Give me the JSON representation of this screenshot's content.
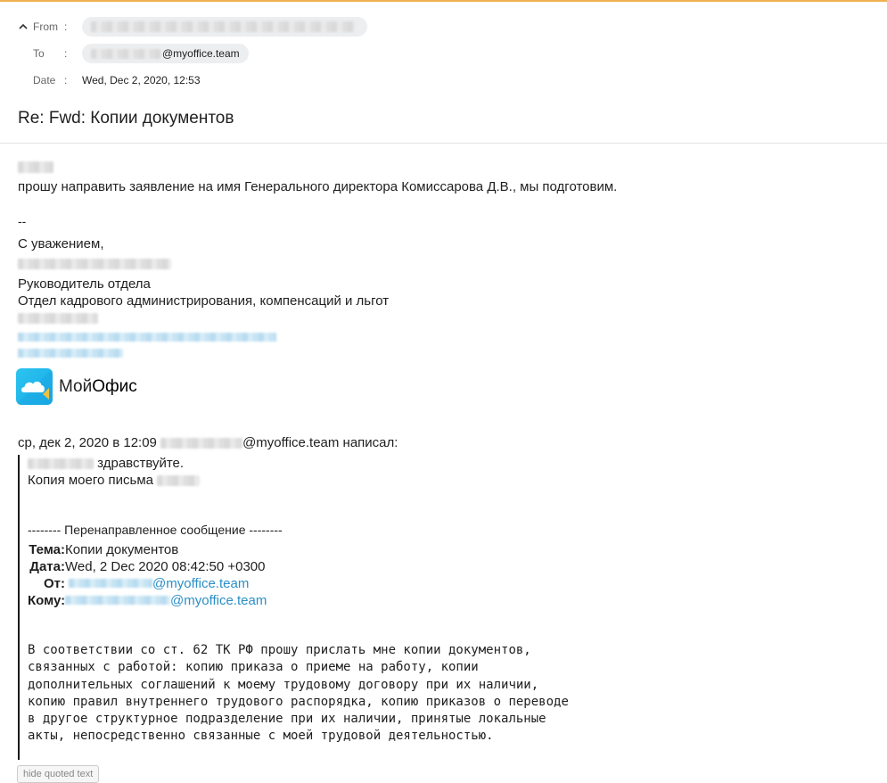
{
  "header": {
    "from_label": "From",
    "to_label": "To",
    "date_label": "Date",
    "colon": ":",
    "to_suffix": "@myoffice.team",
    "date_value": "Wed, Dec 2, 2020, 12:53",
    "subject": "Re: Fwd: Копии документов"
  },
  "body": {
    "request_line": "прошу направить заявление на имя Генерального директора Комиссарова Д.В., мы подготовим.",
    "sig_dash": "--",
    "regards": "С уважением,",
    "position": "Руководитель отдела",
    "department": "Отдел кадрового администрирования, компенсаций и льгот"
  },
  "logo": {
    "text_light": "Мой",
    "text_bold": "Офис"
  },
  "quote": {
    "attribution_prefix": "ср, дек 2, 2020 в 12:09",
    "attribution_suffix": "@myoffice.team написал:",
    "greeting": "здравствуйте.",
    "copy_line": "Копия моего письма",
    "forward_header": "-------- Перенаправленное сообщение --------",
    "fields": [
      {
        "key": "Тема:",
        "value": "Копии документов"
      },
      {
        "key": "Дата:",
        "value": "Wed, 2 Dec 2020 08:42:50 +0300"
      },
      {
        "key": "От:",
        "value": "@myoffice.team"
      },
      {
        "key": "Кому:",
        "value": "@myoffice.team"
      }
    ],
    "body_text": "В соответствии со ст. 62 ТК РФ прошу прислать мне копии документов,\nсвязанных с работой: копию приказа о приеме на работу, копии\nдополнительных соглашений к моему трудовому договору при их наличии,\nкопию правил внутреннего трудового распорядка, копию приказов о переводе\nв другое структурное подразделение при их наличии, принятые локальные\nакты, непосредственно связанные с моей трудовой деятельностью."
  },
  "actions": {
    "hide_quoted": "hide quoted text"
  },
  "colors": {
    "accent_line": "#f0b050",
    "link": "#2a8fc7",
    "logo_blue": "#18a9e6"
  }
}
